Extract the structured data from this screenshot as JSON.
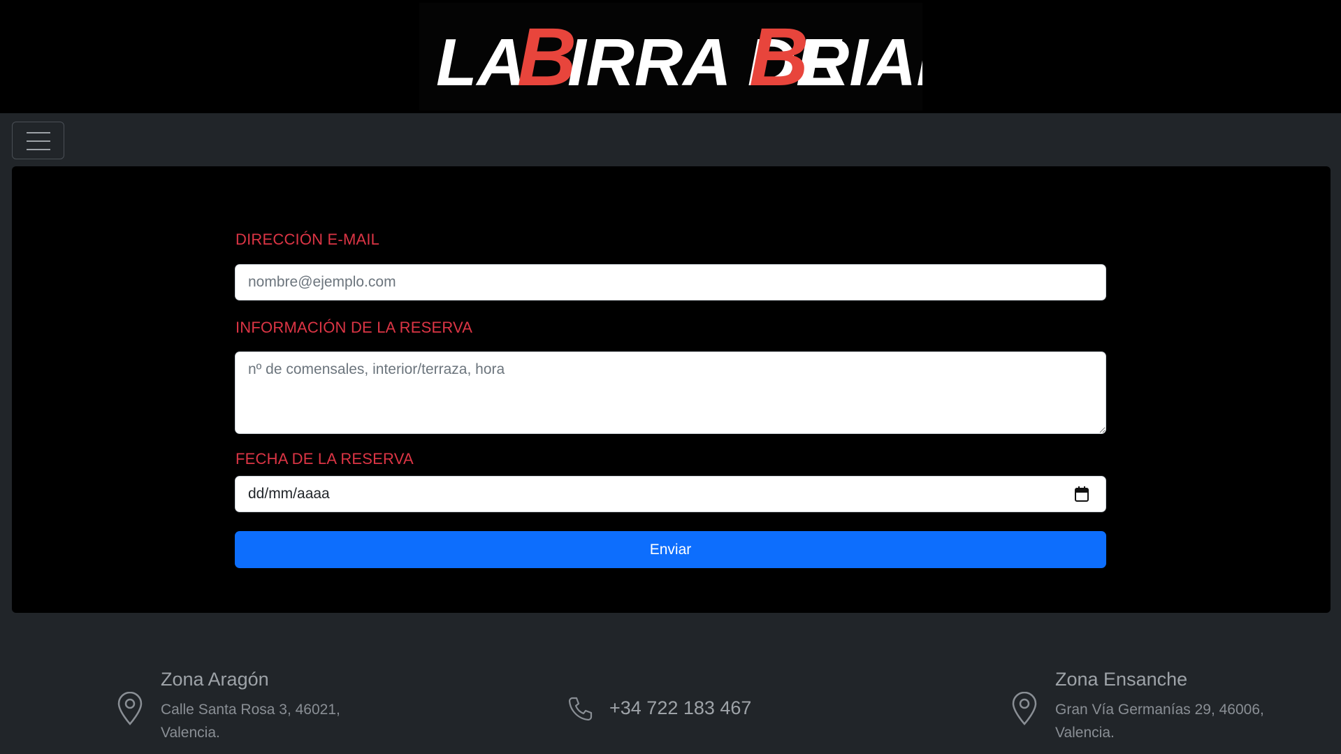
{
  "header": {
    "logo_text_1": "LA",
    "logo_text_2": "B",
    "logo_text_3": "IRRA DE",
    "logo_text_4": "B",
    "logo_text_5": "RIAN",
    "logo_accent": "#e8453c"
  },
  "navbar": {
    "toggler_icon": "hamburger-icon"
  },
  "form": {
    "email_label": "DIRECCIÓN E-MAIL",
    "email_placeholder": "nombre@ejemplo.com",
    "info_label": "INFORMACIÓN DE LA RESERVA",
    "info_placeholder": "nº de comensales, interior/terraza, hora",
    "date_label": "FECHA DE LA RESERVA",
    "date_placeholder": "dd/mm/aaaa",
    "submit_label": "Enviar"
  },
  "footer": {
    "left_title": "Zona Aragón",
    "left_line1": "Calle Santa Rosa 3, 46021,",
    "left_line2": "Valencia.",
    "phone": "+34 722 183 467",
    "right_title": "Zona Ensanche",
    "right_line1": "Gran Vía Germanías 29, 46006,",
    "right_line2": "Valencia."
  },
  "colors": {
    "label_red": "#dc3545",
    "button_blue": "#0d6efd",
    "page_bg": "#212529"
  }
}
